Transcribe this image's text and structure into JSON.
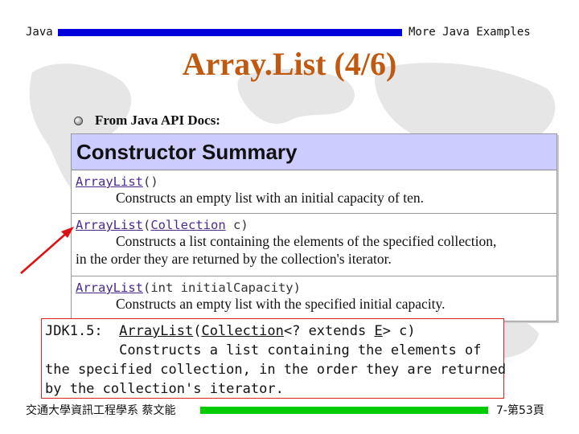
{
  "header": {
    "left_label": "Java",
    "right_label": "More Java Examples"
  },
  "slide": {
    "title": "Array.List (4/6)",
    "bullet_text": "From Java API Docs:"
  },
  "constructor_summary": {
    "heading": "Constructor Summary",
    "rows": [
      {
        "sig_name": "ArrayList",
        "sig_rest": "()",
        "desc": "Constructs an empty list with an initial capacity of ten."
      },
      {
        "sig_name": "ArrayList",
        "sig_open": "(",
        "sig_param_type": "Collection",
        "sig_param": " c)",
        "desc": "Constructs a list containing the elements of the specified collection,",
        "desc_cont": "in the order they are returned by the collection's iterator."
      },
      {
        "sig_name": "ArrayList",
        "sig_rest": "(int initialCapacity)",
        "desc": "Constructs an empty list with the specified initial capacity."
      }
    ]
  },
  "jdk_box": {
    "prefix": "JDK1.5:  ",
    "sig_name": "ArrayList",
    "paren_open": "(",
    "collection": "Collection",
    "generic_start": "<? extends ",
    "type_e": "E",
    "generic_end": "> c)",
    "line2": "         Constructs a list containing the elements of",
    "line3": "the specified collection, in the order they are returned",
    "line4": "by the collection's iterator."
  },
  "footer": {
    "left_label": "交通大學資訊工程學系 蔡文能",
    "right_label": "7-第53頁"
  },
  "colors": {
    "header_bar": "#0000dd",
    "footer_bar": "#00cc00",
    "title": "#c05a10",
    "table_header": "#ccccff",
    "arrow": "#dd1111"
  }
}
